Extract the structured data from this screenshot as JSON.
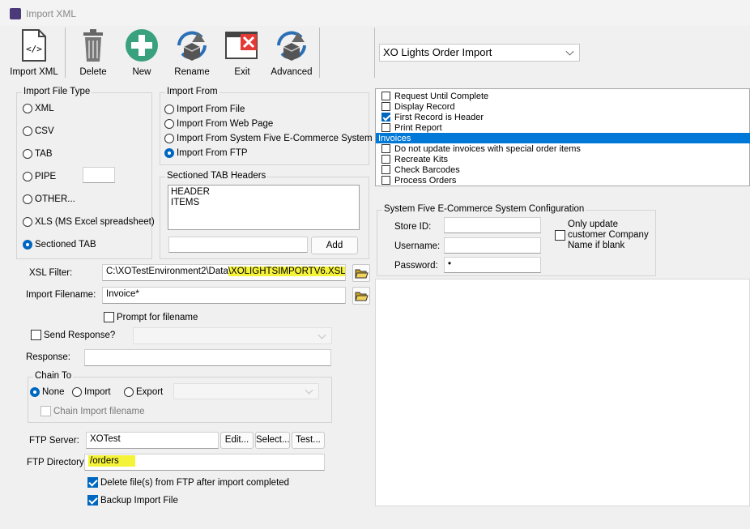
{
  "window": {
    "title": "Import XML"
  },
  "toolbar": {
    "import_xml": "Import XML",
    "delete": "Delete",
    "new": "New",
    "rename": "Rename",
    "exit": "Exit",
    "advanced": "Advanced"
  },
  "profile_select": {
    "value": "XO Lights Order Import"
  },
  "import_file_type": {
    "caption": "Import File Type",
    "options": [
      "XML",
      "CSV",
      "TAB",
      "PIPE",
      "OTHER...",
      "XLS (MS Excel spreadsheet)",
      "Sectioned TAB"
    ],
    "selected": "Sectioned TAB",
    "pipe_value": ""
  },
  "import_from": {
    "caption": "Import From",
    "options": [
      "Import From File",
      "Import From Web Page",
      "Import From System Five E-Commerce System",
      "Import From FTP"
    ],
    "selected": "Import From FTP"
  },
  "sectioned_tab_headers": {
    "caption": "Sectioned TAB Headers",
    "lines": [
      "HEADER",
      "ITEMS"
    ],
    "new_value": "",
    "add_label": "Add"
  },
  "xsl_filter": {
    "label": "XSL Filter:",
    "path_prefix": "C:\\XOTestEnvironment2\\Data",
    "path_highlight": "\\XOLIGHTSIMPORTV6.XSL"
  },
  "import_filename": {
    "label": "Import Filename:",
    "value": "Invoice*"
  },
  "prompt_for_filename": {
    "label": "Prompt for filename"
  },
  "send_response": {
    "label": "Send Response?",
    "value": ""
  },
  "response": {
    "label": "Response:",
    "value": ""
  },
  "chain_to": {
    "caption": "Chain To",
    "options": [
      "None",
      "Import",
      "Export"
    ],
    "selected": "None",
    "chain_value": "",
    "chain_import_filename": "Chain Import filename"
  },
  "ftp": {
    "server_label": "FTP Server:",
    "server_value": "XOTest",
    "edit": "Edit...",
    "select": "Select...",
    "test": "Test...",
    "directory_label": "FTP Directory:",
    "directory_value": "/orders",
    "delete_after": "Delete file(s) from FTP after import completed",
    "backup": "Backup Import File"
  },
  "options_list": [
    {
      "label": "Request Until Complete",
      "checked": false
    },
    {
      "label": "Display Record",
      "checked": false
    },
    {
      "label": "First Record is Header",
      "checked": true
    },
    {
      "label": "Print Report",
      "checked": false
    },
    {
      "label": "Invoices",
      "header": true
    },
    {
      "label": "Do not update invoices with special order items",
      "checked": false
    },
    {
      "label": "Recreate Kits",
      "checked": false
    },
    {
      "label": "Check Barcodes",
      "checked": false
    },
    {
      "label": "Process Orders",
      "checked": false
    }
  ],
  "ecommerce": {
    "caption": "System Five E-Commerce System Configuration",
    "store_id_label": "Store ID:",
    "store_id_value": "",
    "username_label": "Username:",
    "username_value": "",
    "password_label": "Password:",
    "password_value": "•",
    "only_update": "Only update customer Company Name if blank"
  }
}
